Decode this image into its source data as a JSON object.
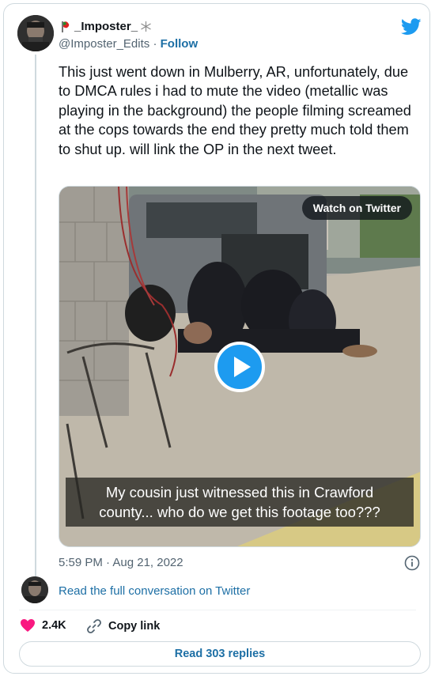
{
  "author": {
    "display_name": "_Imposter_",
    "handle": "@Imposter_Edits",
    "separator": "·",
    "follow_label": "Follow"
  },
  "tweet": {
    "text": "This just went down in Mulberry, AR, unfortunately, due to DMCA rules i had to mute the video (metallic was playing in the background) the people filming screamed at the cops towards the end they pretty much told them to shut up. will link the OP in the next tweet.",
    "timestamp": "5:59 PM · Aug 21, 2022"
  },
  "media": {
    "watch_label": "Watch on Twitter",
    "caption_line1": "My cousin just witnessed this in Crawford",
    "caption_line2": "county... who do we get this footage too???"
  },
  "footer": {
    "read_conversation": "Read the full conversation on Twitter",
    "like_count": "2.4K",
    "copy_link": "Copy link",
    "read_replies": "Read 303 replies"
  },
  "colors": {
    "link_blue": "#1d6fa5",
    "twitter_blue": "#1d9bf0",
    "like_red": "#f91880",
    "secondary_text": "#536471"
  },
  "icons": [
    "twitter-bird-icon",
    "play-icon",
    "info-icon",
    "heart-icon",
    "link-icon"
  ]
}
